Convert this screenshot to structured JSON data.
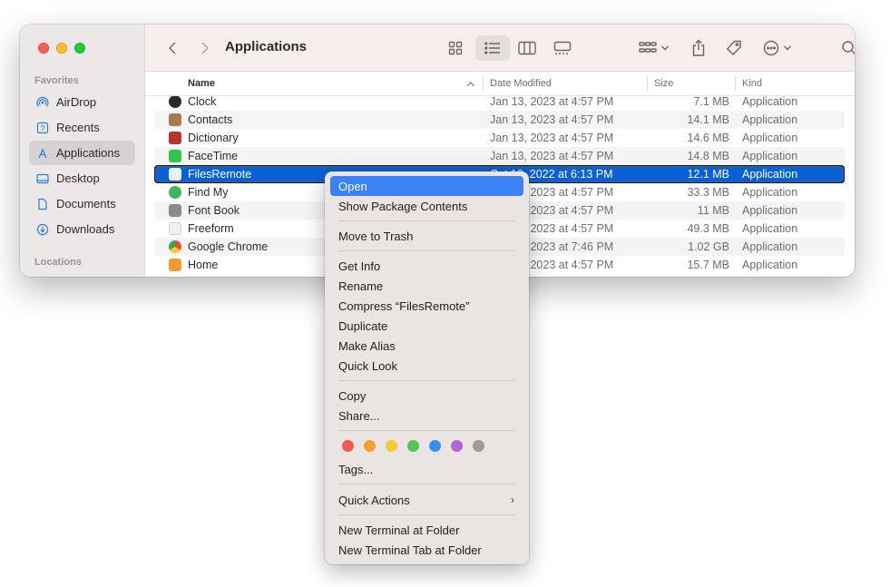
{
  "window": {
    "title": "Applications"
  },
  "sidebar": {
    "sections": [
      {
        "label": "Favorites"
      },
      {
        "label": "Locations"
      }
    ],
    "items": [
      {
        "label": "AirDrop",
        "icon": "airdrop-icon"
      },
      {
        "label": "Recents",
        "icon": "clock-icon"
      },
      {
        "label": "Applications",
        "icon": "applications-icon",
        "selected": true
      },
      {
        "label": "Desktop",
        "icon": "desktop-icon"
      },
      {
        "label": "Documents",
        "icon": "document-icon"
      },
      {
        "label": "Downloads",
        "icon": "download-icon"
      }
    ]
  },
  "columns": {
    "name": "Name",
    "date": "Date Modified",
    "size": "Size",
    "kind": "Kind"
  },
  "files": [
    {
      "name": "Clock",
      "date": "Jan 13, 2023 at 4:57 PM",
      "size": "7.1 MB",
      "kind": "Application",
      "icon_color": "#2a2a2a"
    },
    {
      "name": "Contacts",
      "date": "Jan 13, 2023 at 4:57 PM",
      "size": "14.1 MB",
      "kind": "Application",
      "icon_color": "#a87a4f"
    },
    {
      "name": "Dictionary",
      "date": "Jan 13, 2023 at 4:57 PM",
      "size": "14.6 MB",
      "kind": "Application",
      "icon_color": "#b8322f"
    },
    {
      "name": "FaceTime",
      "date": "Jan 13, 2023 at 4:57 PM",
      "size": "14.8 MB",
      "kind": "Application",
      "icon_color": "#32c24d"
    },
    {
      "name": "FilesRemote",
      "date": "Oct 10, 2022 at 6:13 PM",
      "size": "12.1 MB",
      "kind": "Application",
      "icon_color": "#e9eef6",
      "selected": true
    },
    {
      "name": "Find My",
      "date": "Jan 13, 2023 at 4:57 PM",
      "size": "33.3 MB",
      "kind": "Application",
      "icon_color": "#3cb85a"
    },
    {
      "name": "Font Book",
      "date": "Jan 13, 2023 at 4:57 PM",
      "size": "11 MB",
      "kind": "Application",
      "icon_color": "#8a8a8a"
    },
    {
      "name": "Freeform",
      "date": "Jan 13, 2023 at 4:57 PM",
      "size": "49.3 MB",
      "kind": "Application",
      "icon_color": "#f1f1f1"
    },
    {
      "name": "Google Chrome",
      "date": "Jan 13, 2023 at 7:46 PM",
      "size": "1.02 GB",
      "kind": "Application",
      "icon_color": "#e64a3b"
    },
    {
      "name": "Home",
      "date": "Jan 13, 2023 at 4:57 PM",
      "size": "15.7 MB",
      "kind": "Application",
      "icon_color": "#f29a2e"
    }
  ],
  "context_menu": {
    "items": [
      {
        "label": "Open",
        "highlight": true
      },
      {
        "label": "Show Package Contents"
      },
      {
        "label": "Move to Trash"
      },
      {
        "label": "Get Info"
      },
      {
        "label": "Rename"
      },
      {
        "label": "Compress “FilesRemote”"
      },
      {
        "label": "Duplicate"
      },
      {
        "label": "Make Alias"
      },
      {
        "label": "Quick Look"
      },
      {
        "label": "Copy"
      },
      {
        "label": "Share..."
      },
      {
        "label": "Tags..."
      },
      {
        "label": "Quick Actions",
        "submenu": true
      },
      {
        "label": "New Terminal at Folder"
      },
      {
        "label": "New Terminal Tab at Folder"
      }
    ],
    "tag_colors": [
      {
        "name": "red",
        "color": "#f05a4f"
      },
      {
        "name": "orange",
        "color": "#f5a033"
      },
      {
        "name": "yellow",
        "color": "#f6cb37"
      },
      {
        "name": "green",
        "color": "#52c657"
      },
      {
        "name": "blue",
        "color": "#3a8ef0"
      },
      {
        "name": "purple",
        "color": "#b363d3"
      },
      {
        "name": "gray",
        "color": "#9c9c9c"
      }
    ]
  }
}
